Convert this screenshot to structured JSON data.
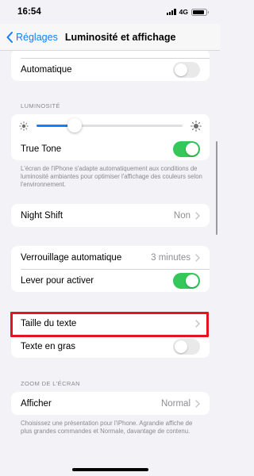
{
  "status": {
    "time": "16:54",
    "network": "4G",
    "battery_level": 0.85
  },
  "nav": {
    "back_label": "Réglages",
    "title": "Luminosité et affichage"
  },
  "appearance": {
    "auto_label": "Automatique",
    "auto_on": false
  },
  "brightness": {
    "header": "LUMINOSITÉ",
    "level": 0.26,
    "true_tone_label": "True Tone",
    "true_tone_on": true,
    "footer": "L'écran de l'iPhone s'adapte automatiquement aux conditions de luminosité ambiantes pour optimiser l'affichage des couleurs selon l'environnement."
  },
  "night_shift": {
    "label": "Night Shift",
    "value": "Non"
  },
  "lock": {
    "auto_lock_label": "Verrouillage automatique",
    "auto_lock_value": "3 minutes",
    "raise_label": "Lever pour activer",
    "raise_on": true
  },
  "text": {
    "size_label": "Taille du texte",
    "bold_label": "Texte en gras",
    "bold_on": false
  },
  "zoom": {
    "header": "ZOOM DE L'ÉCRAN",
    "display_label": "Afficher",
    "display_value": "Normal",
    "footer": "Choisissez une présentation pour l'iPhone. Agrandie affiche de plus grandes commandes et Normale, davantage de contenu."
  },
  "colors": {
    "accent": "#147efb",
    "toggle_on": "#34c759",
    "highlight": "#e3131f"
  }
}
